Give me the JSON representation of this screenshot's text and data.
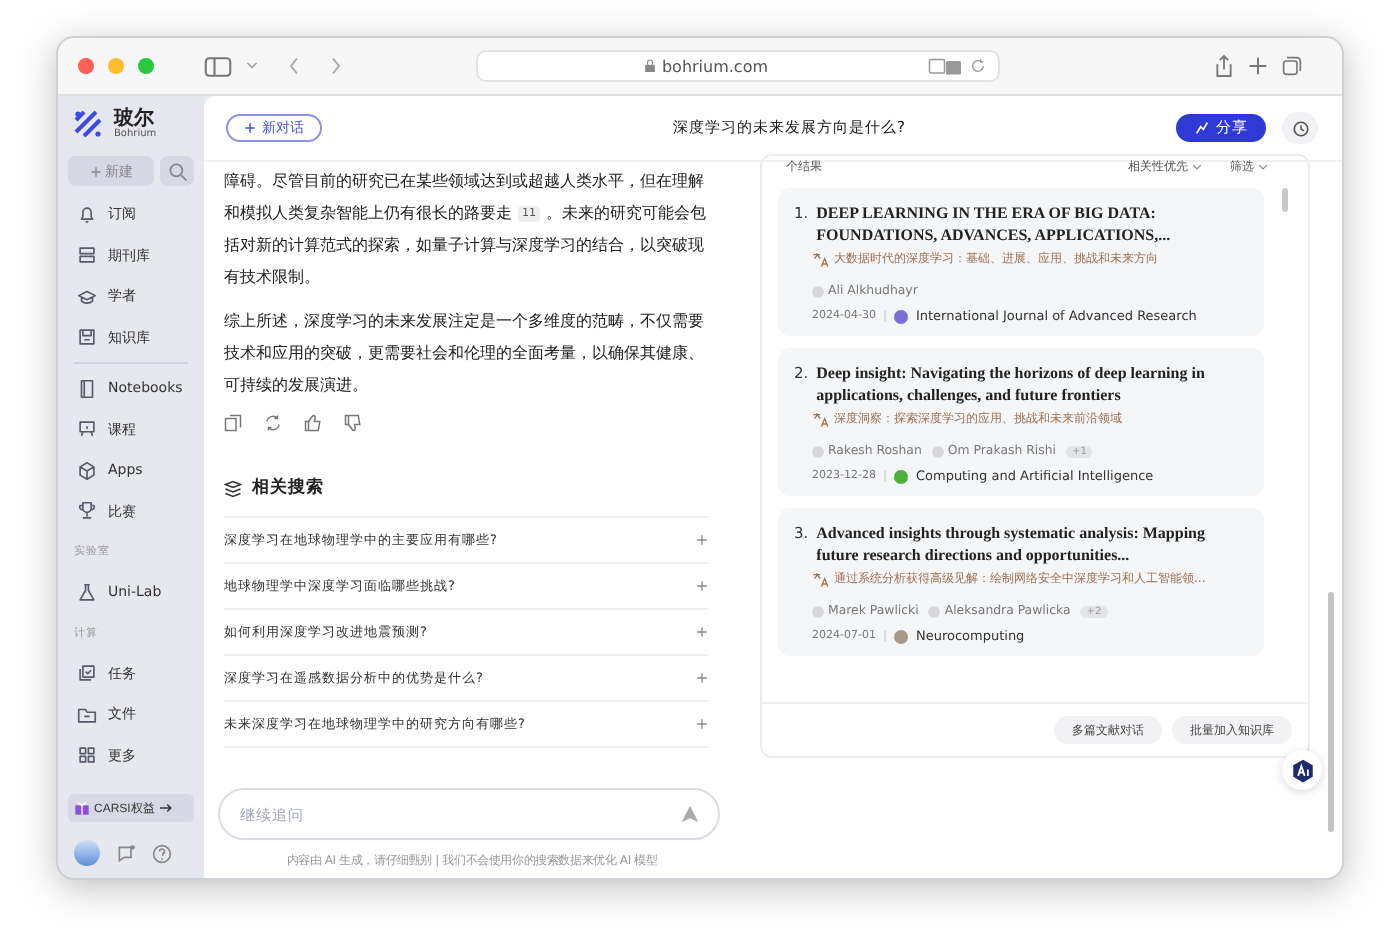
{
  "browser": {
    "url": "bohrium.com"
  },
  "sidebar": {
    "logo": {
      "name": "玻尔",
      "sub": "Bohrium"
    },
    "new_button": "新建",
    "items": [
      {
        "kind": "item",
        "label": "订阅"
      },
      {
        "kind": "item",
        "label": "期刊库"
      },
      {
        "kind": "item",
        "label": "学者"
      },
      {
        "kind": "item",
        "label": "知识库"
      },
      {
        "kind": "divider"
      },
      {
        "kind": "item",
        "label": "Notebooks"
      },
      {
        "kind": "item",
        "label": "课程"
      },
      {
        "kind": "item",
        "label": "Apps"
      },
      {
        "kind": "item",
        "label": "比赛"
      },
      {
        "kind": "section",
        "label": "实验室"
      },
      {
        "kind": "item",
        "label": "Uni-Lab"
      },
      {
        "kind": "section",
        "label": "计算"
      },
      {
        "kind": "item",
        "label": "任务"
      },
      {
        "kind": "item",
        "label": "文件"
      },
      {
        "kind": "item",
        "label": "更多"
      }
    ],
    "promo": "CARSI权益"
  },
  "header": {
    "new_chat": "新对话",
    "title": "深度学习的未来发展方向是什么?",
    "share": "分享"
  },
  "answer": {
    "paragraphs": [
      {
        "text": "障碍。尽管目前的研究已在某些领域达到或超越人类水平，但在理解和模拟人类复杂智能上仍有很长的路要走",
        "citation": "11",
        "text_after": "。未来的研究可能会包括对新的计算范式的探索，如量子计算与深度学习的结合，以突破现有技术限制。"
      },
      {
        "text": "综上所述，深度学习的未来发展注定是一个多维度的范畴，不仅需要技术和应用的突破，更需要社会和伦理的全面考量，以确保其健康、可持续的发展演进。"
      }
    ]
  },
  "related": {
    "title": "相关搜索",
    "items": [
      "深度学习在地球物理学中的主要应用有哪些?",
      "地球物理学中深度学习面临哪些挑战?",
      "如何利用深度学习改进地震预测?",
      "深度学习在遥感数据分析中的优势是什么?",
      "未来深度学习在地球物理学中的研究方向有哪些?"
    ]
  },
  "input": {
    "placeholder": "继续追问"
  },
  "disclaimer": "内容由 AI 生成，请仔细甄别 | 我们不会使用你的搜索数据来优化 AI 模型",
  "results": {
    "summary": "个结果",
    "sort": "相关性优先",
    "filter": "筛选",
    "papers": [
      {
        "number": "1.",
        "title": "DEEP LEARNING IN THE ERA OF BIG DATA: FOUNDATIONS, ADVANCES, APPLICATIONS,...",
        "translation": "大数据时代的深度学习：基础、进展、应用、挑战和未来方向",
        "authors": [
          "Ali Alkhudhayr"
        ],
        "date": "2024-04-30",
        "venue": "International Journal of Advanced Research",
        "color": "#7b6fd6"
      },
      {
        "number": "2.",
        "title": "Deep insight: Navigating the horizons of deep learning in applications, challenges, and future frontiers",
        "translation": "深度洞察：探索深度学习的应用、挑战和未来前沿领域",
        "authors": [
          "Rakesh Roshan",
          "Om Prakash Rishi"
        ],
        "more": "+1",
        "date": "2023-12-28",
        "venue": "Computing and Artificial Intelligence",
        "color": "#4caf3a"
      },
      {
        "number": "3.",
        "title": "Advanced insights through systematic analysis: Mapping future research directions and opportunities...",
        "translation": "通过系统分析获得高级见解：绘制网络安全中深度学习和人工智能领...",
        "authors": [
          "Marek Pawlicki",
          "Aleksandra Pawlicka"
        ],
        "more": "+2",
        "date": "2024-07-01",
        "venue": "Neurocomputing",
        "color": "#a89a88"
      }
    ],
    "actions": [
      "多篇文献对话",
      "批量加入知识库"
    ]
  }
}
